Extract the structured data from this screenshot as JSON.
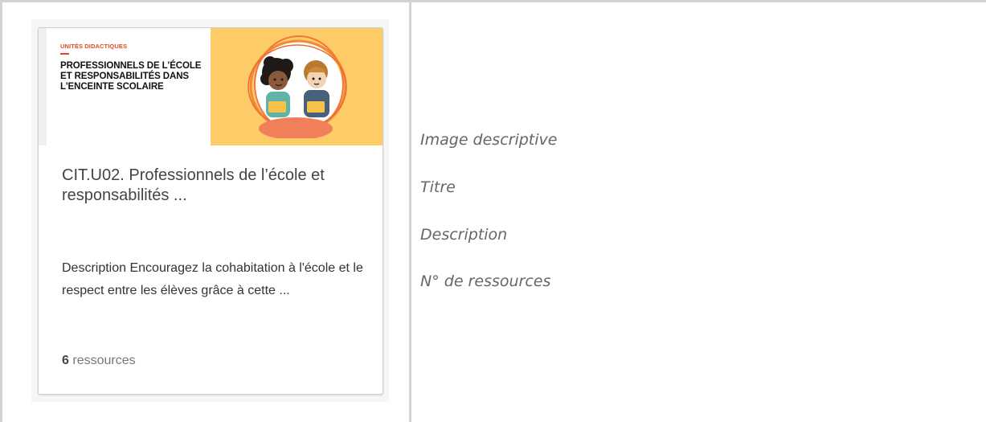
{
  "card": {
    "banner": {
      "eyebrow": "UNITÉS DIDACTIQUES",
      "title": "PROFESSIONNELS DE L'ÉCOLE ET RESPONSABILITÉS DANS L'ENCEINTE SCOLAIRE",
      "illustration": "two-children-reading-illustration"
    },
    "title": "CIT.U02. Professionnels de l’école et responsabilités ...",
    "description": "Description Encouragez la cohabitation à l'école et le respect entre les élèves grâce à cette ...",
    "resource_count": "6",
    "resource_label": "ressources"
  },
  "legend": {
    "items": [
      "Image descriptive",
      "Titre",
      "Description",
      "N° de ressources"
    ]
  },
  "colors": {
    "banner_accent": "#fdcc66",
    "eyebrow": "#e04a22",
    "frame": "#d4d4d4"
  }
}
